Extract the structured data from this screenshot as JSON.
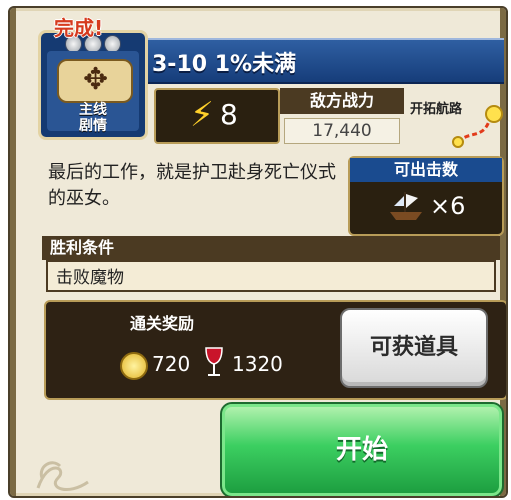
{
  "mission": {
    "status": "完成!",
    "category_line1": "主线",
    "category_line2": "剧情",
    "title": "3-10 1%未满",
    "energy_cost": "8",
    "enemy_power_label": "敌方战力",
    "enemy_power_value": "17,440",
    "route_label": "开拓航路",
    "description": "最后的工作，就是护卫赴身死亡仪式的巫女。",
    "sortie_label": "可出击数",
    "sortie_value": "×6",
    "victory_condition_label": "胜利条件",
    "victory_condition_value": "击败魔物",
    "rewards_label": "通关奖励",
    "gold_reward": "720",
    "wine_reward": "1320",
    "items_button": "可获道具",
    "start_button": "开始"
  },
  "icons": {
    "stars": [
      "star-icon",
      "star-icon",
      "star-icon"
    ],
    "energy": "lightning-bolt-icon",
    "ship": "ship-icon",
    "coin": "gold-coin-icon",
    "wine": "wine-glass-icon",
    "route": "route-path-icon",
    "emblem": "map-compass-icon"
  },
  "colors": {
    "title_bar": "#1f4d91",
    "done_text": "#d63a1e",
    "start_button": "#3ccf61",
    "panel_dark": "#2e2214",
    "accent_gold": "#b89c58"
  }
}
